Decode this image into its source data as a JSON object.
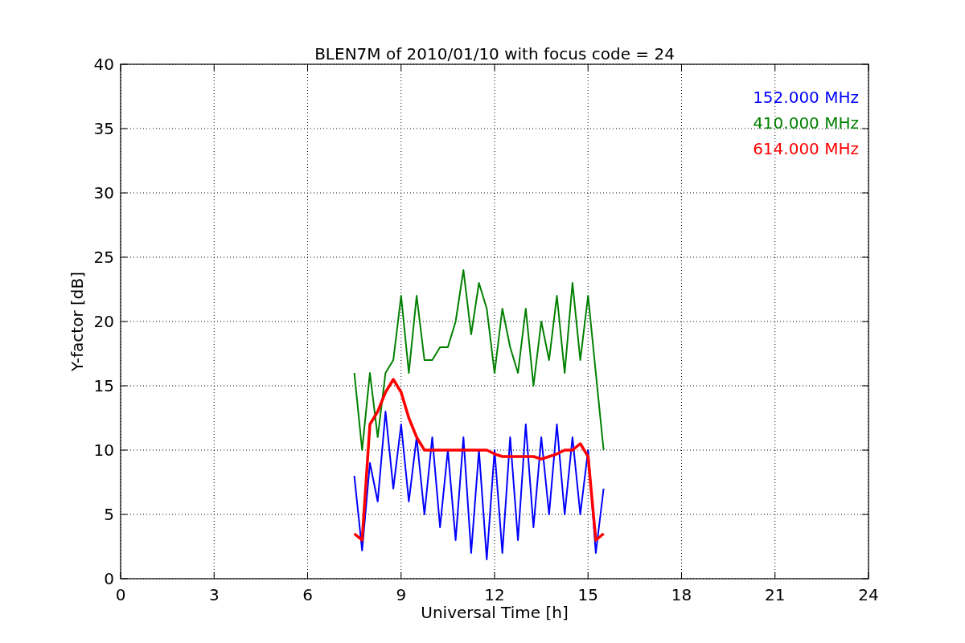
{
  "figure": {
    "chart_data": {
      "type": "line",
      "grid": true,
      "title": "BLEN7M of 2010/01/10 with focus code = 24",
      "xlabel": "Universal Time [h]",
      "ylabel": "Y-factor [dB]",
      "xlim": [
        0,
        24
      ],
      "ylim": [
        0,
        40
      ],
      "xticks": [
        0,
        3,
        6,
        9,
        12,
        15,
        18,
        21,
        24
      ],
      "yticks": [
        0,
        5,
        10,
        15,
        20,
        25,
        30,
        35,
        40
      ],
      "x": [
        7.5,
        7.75,
        8,
        8.25,
        8.5,
        8.75,
        9,
        9.25,
        9.5,
        9.75,
        10,
        10.25,
        10.5,
        10.75,
        11,
        11.25,
        11.5,
        11.75,
        12,
        12.25,
        12.5,
        12.75,
        13,
        13.25,
        13.5,
        13.75,
        14,
        14.25,
        14.5,
        14.75,
        15,
        15.25,
        15.5
      ],
      "series": [
        {
          "name": "152.000 MHz",
          "color": "#0000ff",
          "values": [
            8,
            2.2,
            9,
            6,
            13,
            7,
            12,
            6,
            11,
            5,
            11,
            4,
            10,
            3,
            11,
            2,
            10,
            1.5,
            10,
            2,
            11,
            3,
            12,
            4,
            11,
            5,
            12,
            5,
            11,
            5,
            10,
            2,
            7
          ]
        },
        {
          "name": "410.000 MHz",
          "color": "#008000",
          "values": [
            16,
            10,
            16,
            11,
            16,
            17,
            22,
            16,
            22,
            17,
            17,
            18,
            18,
            20,
            24,
            19,
            23,
            21,
            16,
            21,
            18,
            16,
            21,
            15,
            20,
            17,
            22,
            16,
            23,
            17,
            22,
            16,
            10
          ]
        },
        {
          "name": "614.000 MHz",
          "color": "#ff0000",
          "values": [
            3.5,
            3,
            12,
            13,
            14.5,
            15.5,
            14.5,
            12.5,
            11,
            10,
            10,
            10,
            10,
            10,
            10,
            10,
            10,
            10,
            9.7,
            9.5,
            9.5,
            9.5,
            9.5,
            9.5,
            9.3,
            9.5,
            9.7,
            10,
            10,
            10.5,
            9.5,
            3,
            3.5
          ]
        }
      ]
    }
  }
}
